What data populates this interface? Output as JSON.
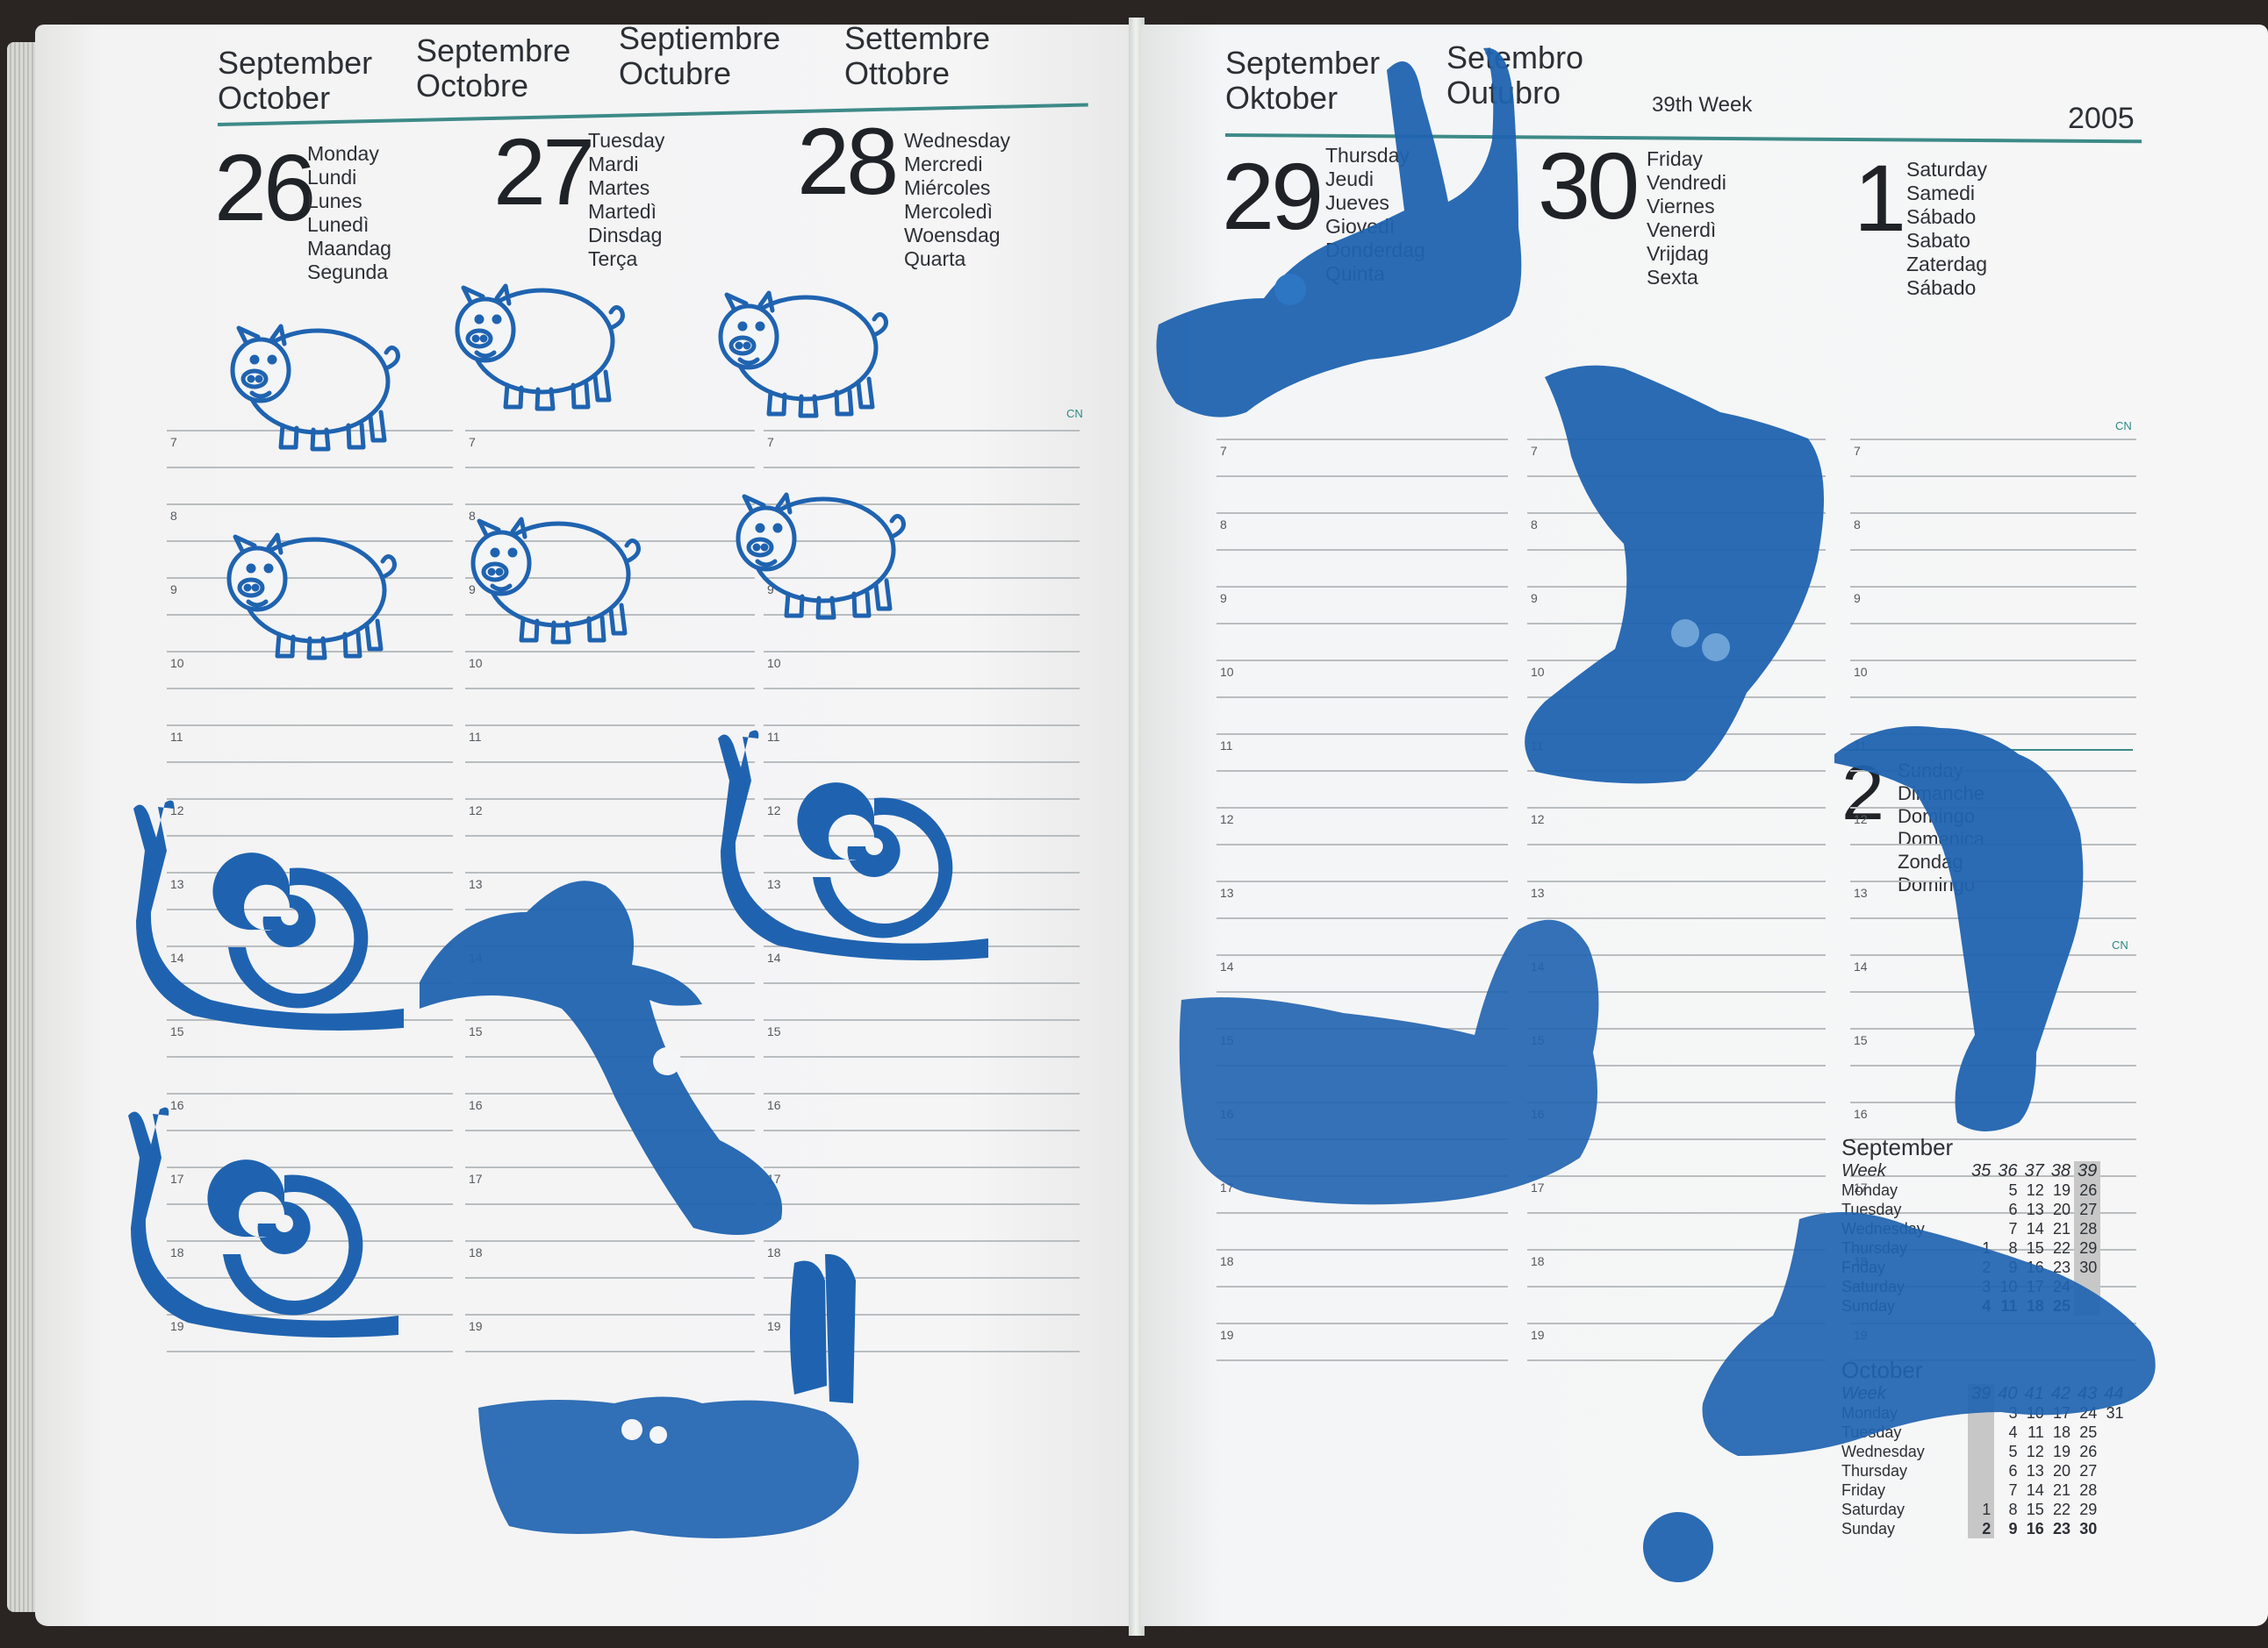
{
  "left_page": {
    "headers": [
      {
        "lines": [
          "September",
          "October"
        ]
      },
      {
        "lines": [
          "Septembre",
          "Octobre"
        ]
      },
      {
        "lines": [
          "Septiembre",
          "Octubre"
        ]
      },
      {
        "lines": [
          "Settembre",
          "Ottobre"
        ]
      }
    ],
    "days": [
      {
        "number": "26",
        "names": [
          "Monday",
          "Lundi",
          "Lunes",
          "Lunedì",
          "Maandag",
          "Segunda"
        ]
      },
      {
        "number": "27",
        "names": [
          "Tuesday",
          "Mardi",
          "Martes",
          "Martedì",
          "Dinsdag",
          "Terça"
        ]
      },
      {
        "number": "28",
        "names": [
          "Wednesday",
          "Mercredi",
          "Miércoles",
          "Mercoledì",
          "Woensdag",
          "Quarta"
        ]
      }
    ],
    "hours": [
      "7",
      "8",
      "9",
      "10",
      "11",
      "12",
      "13",
      "14",
      "15",
      "16",
      "17",
      "18",
      "19"
    ],
    "cn": "CN"
  },
  "right_page": {
    "headers": [
      {
        "lines": [
          "September",
          "Oktober"
        ]
      },
      {
        "lines": [
          "Setembro",
          "Outubro"
        ]
      }
    ],
    "week_label": "39th Week",
    "year": "2005",
    "days": [
      {
        "number": "29",
        "names": [
          "Thursday",
          "Jeudi",
          "Jueves",
          "Giovedì",
          "Donderdag",
          "Quinta"
        ]
      },
      {
        "number": "30",
        "names": [
          "Friday",
          "Vendredi",
          "Viernes",
          "Venerdì",
          "Vrijdag",
          "Sexta"
        ]
      },
      {
        "number": "1",
        "names": [
          "Saturday",
          "Samedi",
          "Sábado",
          "Sabato",
          "Zaterdag",
          "Sábado"
        ]
      }
    ],
    "sunday": {
      "number": "2",
      "names": [
        "Sunday",
        "Dimanche",
        "Domingo",
        "Domenica",
        "Zondag",
        "Domingo"
      ]
    },
    "hours": [
      "7",
      "8",
      "9",
      "10",
      "11",
      "12",
      "13",
      "14",
      "15",
      "16",
      "17",
      "18",
      "19"
    ],
    "cn": "CN",
    "mini_calendars": [
      {
        "month": "September",
        "week_label": "Week",
        "weeks": [
          "35",
          "36",
          "37",
          "38",
          "39"
        ],
        "rows": [
          {
            "day": "Monday",
            "cells": [
              "",
              "5",
              "12",
              "19",
              "26"
            ]
          },
          {
            "day": "Tuesday",
            "cells": [
              "",
              "6",
              "13",
              "20",
              "27"
            ]
          },
          {
            "day": "Wednesday",
            "cells": [
              "",
              "7",
              "14",
              "21",
              "28"
            ]
          },
          {
            "day": "Thursday",
            "cells": [
              "1",
              "8",
              "15",
              "22",
              "29"
            ]
          },
          {
            "day": "Friday",
            "cells": [
              "2",
              "9",
              "16",
              "23",
              "30"
            ]
          },
          {
            "day": "Saturday",
            "cells": [
              "3",
              "10",
              "17",
              "24",
              ""
            ]
          },
          {
            "day": "Sunday",
            "cells": [
              "4",
              "11",
              "18",
              "25",
              ""
            ]
          }
        ]
      },
      {
        "month": "October",
        "week_label": "Week",
        "weeks": [
          "39",
          "40",
          "41",
          "42",
          "43",
          "44"
        ],
        "rows": [
          {
            "day": "Monday",
            "cells": [
              "",
              "3",
              "10",
              "17",
              "24",
              "31"
            ]
          },
          {
            "day": "Tuesday",
            "cells": [
              "",
              "4",
              "11",
              "18",
              "25",
              ""
            ]
          },
          {
            "day": "Wednesday",
            "cells": [
              "",
              "5",
              "12",
              "19",
              "26",
              ""
            ]
          },
          {
            "day": "Thursday",
            "cells": [
              "",
              "6",
              "13",
              "20",
              "27",
              ""
            ]
          },
          {
            "day": "Friday",
            "cells": [
              "",
              "7",
              "14",
              "21",
              "28",
              ""
            ]
          },
          {
            "day": "Saturday",
            "cells": [
              "1",
              "8",
              "15",
              "22",
              "29",
              ""
            ]
          },
          {
            "day": "Sunday",
            "cells": [
              "2",
              "9",
              "16",
              "23",
              "30",
              ""
            ]
          }
        ]
      }
    ]
  },
  "colors": {
    "stamp_ink": "#1f63b0",
    "paper": "#f4f5f6",
    "accent_rule": "#3d8a88"
  }
}
